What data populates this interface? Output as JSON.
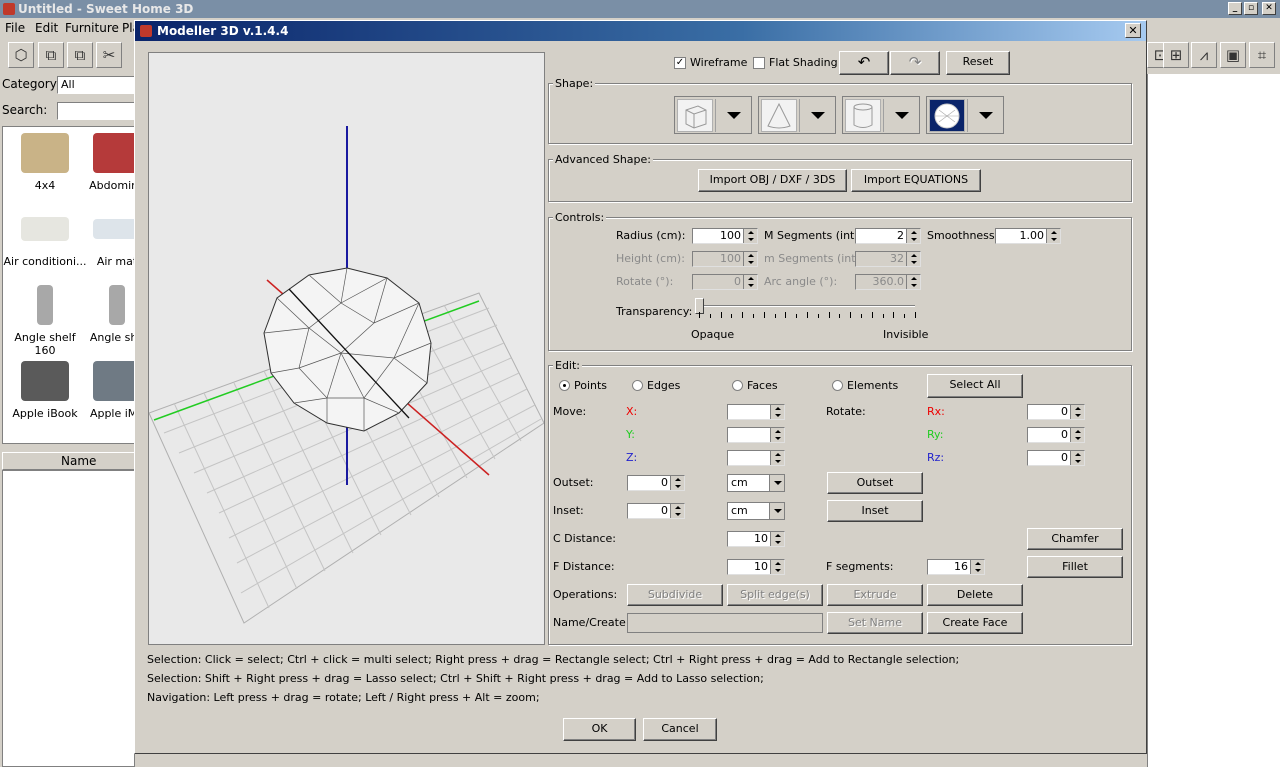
{
  "main_window": {
    "title": "Untitled - Sweet Home 3D",
    "menu": [
      "File",
      "Edit",
      "Furniture",
      "Pla"
    ],
    "category_label": "Category:",
    "category_value": "All",
    "search_label": "Search:",
    "catalog_items": [
      "4x4",
      "Abdomina",
      "Air conditioni...",
      "Air mat",
      "Angle shelf 160",
      "Angle she",
      "Apple iBook",
      "Apple iMa"
    ],
    "name_column": "Name"
  },
  "dialog": {
    "title": "Modeller 3D v.1.4.4",
    "wireframe_label": "Wireframe",
    "wireframe_checked": true,
    "flat_shading_label": "Flat Shading",
    "flat_shading_checked": false,
    "reset_label": "Reset",
    "shape_group": "Shape:",
    "advanced_group": "Advanced Shape:",
    "import_obj_label": "Import  OBJ / DXF / 3DS",
    "import_eq_label": "Import  EQUATIONS",
    "controls_group": "Controls:",
    "radius_label": "Radius (cm):",
    "radius_value": "100",
    "m_segments_label": "M Segments (int):",
    "m_segments_value": "2",
    "smoothness_label": "Smoothness:",
    "smoothness_value": "1.00",
    "height_label": "Height (cm):",
    "height_value": "100",
    "m_segments2_label": "m Segments (int):",
    "m_segments2_value": "32",
    "rotate_label": "Rotate (°):",
    "rotate_value": "0",
    "arc_label": "Arc angle (°):",
    "arc_value": "360.0",
    "transparency_label": "Transparency:",
    "transparency_level": 0,
    "opaque_label": "Opaque",
    "invisible_label": "Invisible",
    "edit_group": "Edit:",
    "points_label": "Points",
    "edges_label": "Edges",
    "faces_label": "Faces",
    "elements_label": "Elements",
    "selected_mode": "Points",
    "select_all_label": "Select All",
    "move_label": "Move:",
    "x_label": "X:",
    "y_label": "Y:",
    "z_label": "Z:",
    "rotate2_label": "Rotate:",
    "rx_label": "Rx:",
    "ry_label": "Ry:",
    "rz_label": "Rz:",
    "rx_value": "0",
    "ry_value": "0",
    "rz_value": "0",
    "outset_label": "Outset:",
    "outset_value": "0",
    "outset_unit": "cm",
    "outset_button": "Outset",
    "inset_label": "Inset:",
    "inset_value": "0",
    "inset_unit": "cm",
    "inset_button": "Inset",
    "c_distance_label": "C Distance:",
    "c_distance_value": "10",
    "chamfer_button": "Chamfer",
    "f_distance_label": "F Distance:",
    "f_distance_value": "10",
    "f_segments_label": "F segments:",
    "f_segments_value": "16",
    "fillet_button": "Fillet",
    "operations_label": "Operations:",
    "subdivide_button": "Subdivide",
    "split_edges_button": "Split edge(s)",
    "extrude_button": "Extrude",
    "delete_button": "Delete",
    "name_create_label": "Name/Create:",
    "set_name_button": "Set Name",
    "create_face_button": "Create Face",
    "help_line1": "Selection: Click = select; Ctrl + click = multi select; Right press + drag = Rectangle select; Ctrl + Right press + drag = Add to Rectangle selection;",
    "help_line2": "Selection: Shift + Right press + drag = Lasso select; Ctrl + Shift + Right press + drag = Add to Lasso selection;",
    "help_line3": "Navigation: Left press + drag = rotate; Left / Right press + Alt = zoom;",
    "ok_label": "OK",
    "cancel_label": "Cancel"
  },
  "colors": {
    "axis_x": "#cc0000",
    "axis_y": "#00cc00",
    "axis_z": "#0000aa",
    "dialog_title": "#0a246a"
  }
}
